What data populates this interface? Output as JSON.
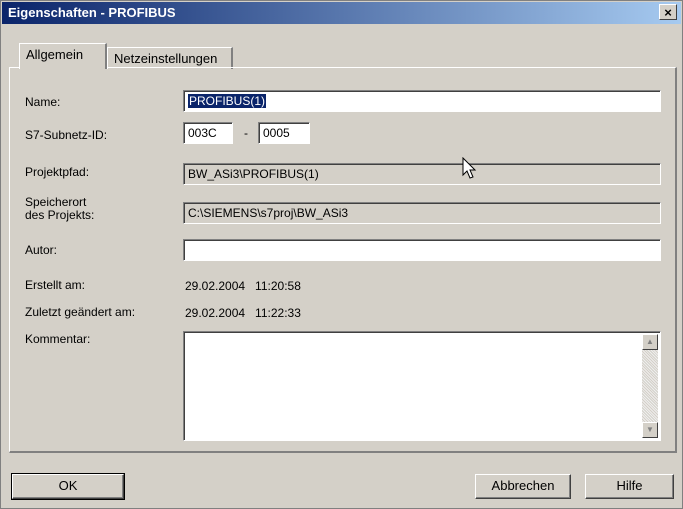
{
  "window": {
    "title": "Eigenschaften - PROFIBUS",
    "close_glyph": "×"
  },
  "tabs": [
    {
      "label": "Allgemein",
      "active": true
    },
    {
      "label": "Netzeinstellungen",
      "active": false
    }
  ],
  "form": {
    "name_label": "Name:",
    "name_value": "PROFIBUS(1)",
    "subnet_label": "S7-Subnetz-ID:",
    "subnet_part1": "003C",
    "subnet_sep": "-",
    "subnet_part2": "0005",
    "path_label": "Projektpfad:",
    "path_value": "BW_ASi3\\PROFIBUS(1)",
    "location_label": "Speicherort\ndes Projekts:",
    "location_value": "C:\\SIEMENS\\s7proj\\BW_ASi3",
    "author_label": "Autor:",
    "author_value": "",
    "created_label": "Erstellt am:",
    "created_value": "29.02.2004   11:20:58",
    "modified_label": "Zuletzt geändert am:",
    "modified_value": "29.02.2004   11:22:33",
    "comment_label": "Kommentar:",
    "comment_value": ""
  },
  "buttons": {
    "ok": "OK",
    "cancel": "Abbrechen",
    "help": "Hilfe"
  },
  "icons": {
    "scroll_up": "up-arrow-icon",
    "scroll_down": "down-arrow-icon",
    "pointer": "mouse-pointer-icon"
  }
}
